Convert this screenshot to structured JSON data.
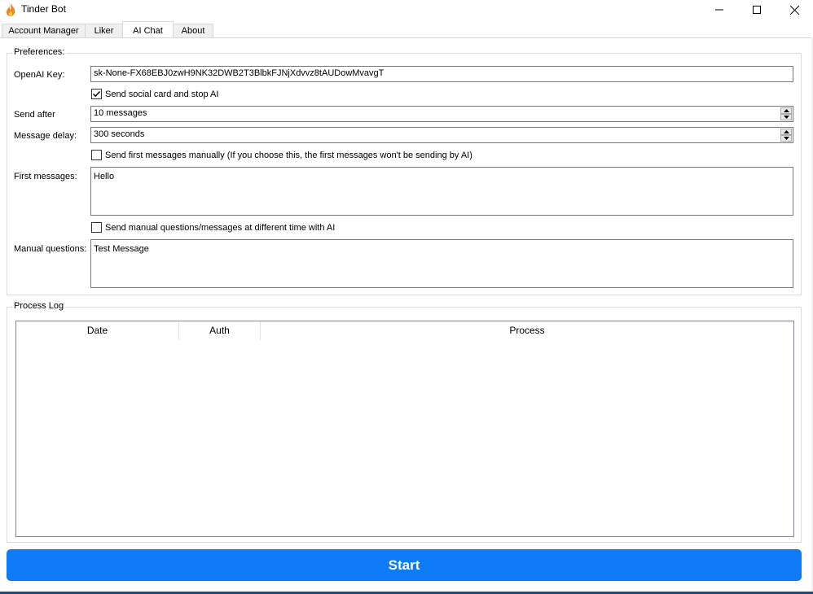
{
  "window": {
    "title": "Tinder Bot",
    "icon": "flame-icon"
  },
  "tabs": [
    {
      "label": "Account Manager",
      "active": false
    },
    {
      "label": "Liker",
      "active": false
    },
    {
      "label": "AI Chat",
      "active": true
    },
    {
      "label": "About",
      "active": false
    }
  ],
  "preferences": {
    "legend": "Preferences:",
    "openai_key": {
      "label": "OpenAI Key:",
      "value": "sk-None-FX68EBJ0zwH9NK32DWB2T3BlbkFJNjXdvvz8tAUDowMvavgT"
    },
    "social_card": {
      "label": "Send social card and stop AI",
      "checked": true
    },
    "send_after": {
      "label": "Send after",
      "value": "10 messages"
    },
    "message_delay": {
      "label": "Message delay:",
      "value": "300 seconds"
    },
    "first_manual": {
      "label": "Send first messages manually (If you choose this, the first messages won't be sending by AI)",
      "checked": false
    },
    "first_messages": {
      "label": "First messages:",
      "value": "Hello"
    },
    "manual_questions_toggle": {
      "label": "Send manual questions/messages at different time with AI",
      "checked": false
    },
    "manual_questions": {
      "label": "Manual questions:",
      "value": "Test Message"
    }
  },
  "process_log": {
    "legend": "Process Log",
    "columns": [
      "Date",
      "Auth",
      "Process"
    ],
    "rows": []
  },
  "start_button": {
    "label": "Start",
    "color": "#0f7bf6"
  }
}
